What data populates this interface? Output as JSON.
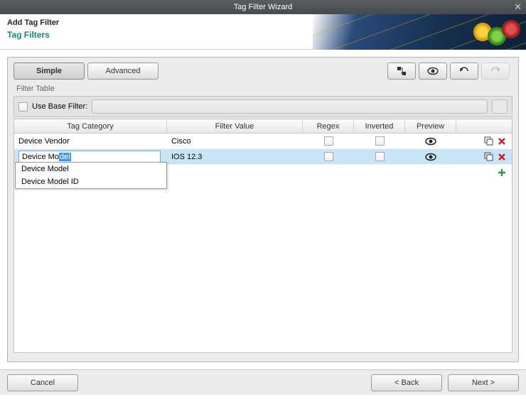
{
  "window": {
    "title": "Tag Filter Wizard"
  },
  "header": {
    "subtitle": "Add Tag Filter",
    "section": "Tag Filters"
  },
  "tabs": {
    "simple": "Simple",
    "advanced": "Advanced"
  },
  "filter_table_label": "Filter Table",
  "base_filter": {
    "checkbox_label": "Use Base Filter:"
  },
  "columns": {
    "category": "Tag Category",
    "value": "Filter Value",
    "regex": "Regex",
    "inverted": "Inverted",
    "preview": "Preview"
  },
  "rows": [
    {
      "category": "Device Vendor",
      "value": "Cisco",
      "regex": false,
      "inverted": false,
      "selected": false,
      "editing": false
    },
    {
      "category": "Device Model",
      "value": "IOS 12.3",
      "regex": false,
      "inverted": false,
      "selected": true,
      "editing": true,
      "edit_prefix": "Device Mo",
      "edit_selection": "del"
    }
  ],
  "autocomplete": [
    "Device Model",
    "Device Model ID"
  ],
  "footer": {
    "cancel": "Cancel",
    "back": "< Back",
    "next": "Next >"
  }
}
